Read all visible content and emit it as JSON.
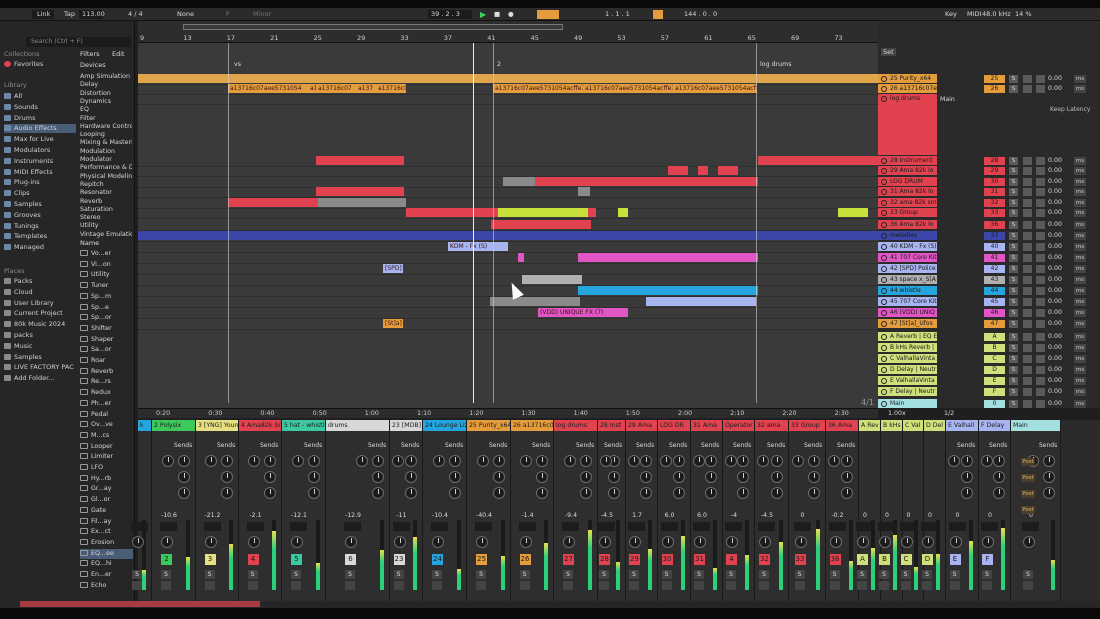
{
  "topbar": {
    "link": "Link",
    "tap": "Tap",
    "tempo": "113.00",
    "sig": "4 / 4",
    "quant": "None",
    "key_root": "F",
    "scale": "Minor",
    "position": "39 .  2 .  3",
    "loop_start": "1 .  1 .  1",
    "loop_len": "144 .  0 .  0",
    "key_label": "Key",
    "midi_label": "MIDI",
    "sample_rate": "48.0 kHz",
    "cpu": "14 %"
  },
  "browser": {
    "search_placeholder": "Search (Ctrl + F)",
    "filters": "Filters",
    "edit": "Edit",
    "collections": "Collections",
    "favorites": "Favorites",
    "library": "Library",
    "items": [
      "All",
      "Sounds",
      "Drums",
      "Audio Effects",
      "Max for Live",
      "Modulators",
      "Instruments",
      "MIDI Effects",
      "Plug-ins",
      "Clips",
      "Samples",
      "Grooves",
      "Tunings",
      "Templates",
      "Managed"
    ],
    "places": "Places",
    "place_items": [
      "Packs",
      "Cloud",
      "User Library",
      "Current Project",
      "80k Music 2024",
      "packs",
      "Music",
      "Samples",
      "LIVE FACTORY PAC",
      "Add Folder..."
    ],
    "devices_header": "Devices",
    "devices": [
      "Amp Simulation",
      "Delay",
      "Distortion",
      "Dynamics",
      "EQ",
      "Filter",
      "Hardware Control",
      "Looping",
      "Mixing & Mastering",
      "Modulation",
      "Modulator",
      "Performance & DJ",
      "Physical Modeling",
      "Repitch",
      "Resonator",
      "Reverb",
      "Saturation",
      "Stereo",
      "Utility",
      "Vintage Emulation"
    ],
    "name_header": "Name",
    "names": [
      "Vo...er",
      "Vi...on",
      "Utility",
      "Tuner",
      "Sp...m",
      "Sp...e",
      "Sp...or",
      "Shifter",
      "Shaper",
      "Sa...or",
      "Roar",
      "Reverb",
      "Re...rs",
      "Redux",
      "Ph...er",
      "Pedal",
      "Ov...ve",
      "M...cs",
      "Looper",
      "Limiter",
      "LFO",
      "Hy...rb",
      "Gr...ay",
      "Gl...or",
      "Gate",
      "Fil...ay",
      "Ex...ct",
      "Erosion",
      "EQ...ee",
      "EQ...hi",
      "En...er",
      "Echo"
    ]
  },
  "arrangement": {
    "ruler_numbers": [
      "9",
      "13",
      "17",
      "21",
      "25",
      "29",
      "33",
      "37",
      "41",
      "45",
      "49",
      "53",
      "57",
      "61",
      "65",
      "69",
      "73"
    ],
    "locators": [
      "vs",
      "2",
      "log drums"
    ],
    "clip_labels": [
      "a13716c07aee5731054",
      "a137",
      "a13716c07",
      "a137",
      "a13716c07aee",
      "a13716c07aee5731054acffe74",
      "a13716c07aee5731054acffe74",
      "a13716c07aee5731054acffe74"
    ],
    "other_labels": [
      "KDM - Fx (S)",
      "[SPD] P",
      "(VDD) UNIQUE FX (7)",
      "[St]a]"
    ],
    "time_markers": [
      "0:20",
      "0:30",
      "0:40",
      "0:50",
      "1:00",
      "1:10",
      "1:20",
      "1:30",
      "1:40",
      "1:50",
      "2:00",
      "2:10",
      "2:20",
      "2:30"
    ],
    "fraction": "4/1",
    "zoom": "1.00x"
  },
  "tracks": [
    {
      "name": "25 Purity_x64",
      "num": "25",
      "color": "#e59c3d",
      "val": "0.00"
    },
    {
      "name": "26 a13716c07e",
      "num": "26",
      "color": "#e59c3d",
      "val": "0.00"
    },
    {
      "name": "log drums",
      "num": "",
      "color": "#e0434f",
      "val": ""
    },
    {
      "name": "28 Instrument",
      "num": "28",
      "color": "#e0434f",
      "val": "0.00"
    },
    {
      "name": "29 Ama 82k lo",
      "num": "29",
      "color": "#e0434f",
      "val": "0.00"
    },
    {
      "name": "LOG DRUM",
      "num": "30",
      "color": "#e0434f",
      "val": "0.00"
    },
    {
      "name": "31 Ama 82k lo",
      "num": "31",
      "color": "#e0434f",
      "val": "0.00"
    },
    {
      "name": "32 ama 82k sm",
      "num": "32",
      "color": "#e0434f",
      "val": "0.00"
    },
    {
      "name": "33 Group",
      "num": "33",
      "color": "#e0434f",
      "val": "0.00"
    },
    {
      "name": "36 Ama 82k lo",
      "num": "36",
      "color": "#e0434f",
      "val": "0.00"
    },
    {
      "name": "melodies",
      "num": "37",
      "color": "#3b46a8",
      "val": "0.00"
    },
    {
      "name": "40 KDM - Fx (S)",
      "num": "40",
      "color": "#a8b4f0",
      "val": "0.00"
    },
    {
      "name": "41 707 Core Kit",
      "num": "41",
      "color": "#e255c5",
      "val": "0.00"
    },
    {
      "name": "42 [SPD] Police",
      "num": "42",
      "color": "#a8b4f0",
      "val": "0.00"
    },
    {
      "name": "43 space x_S[A",
      "num": "43",
      "color": "#b0b0b0",
      "val": "0.00"
    },
    {
      "name": "44 whistle",
      "num": "44",
      "color": "#25a5e0",
      "val": "0.00"
    },
    {
      "name": "45 707 Core Kit",
      "num": "45",
      "color": "#a8b4f0",
      "val": "0.00"
    },
    {
      "name": "46 (VDD) UNIQ",
      "num": "46",
      "color": "#e255c5",
      "val": "0.00"
    },
    {
      "name": "47 [St]a]_Ufos",
      "num": "47",
      "color": "#e59c3d",
      "val": "0.00"
    },
    {
      "name": "A Reverb | EQ Ei",
      "num": "A",
      "color": "#cfe07a",
      "val": "0.00"
    },
    {
      "name": "B kHs Reverb |",
      "num": "B",
      "color": "#cfe07a",
      "val": "0.00"
    },
    {
      "name": "C ValhallaVinta",
      "num": "C",
      "color": "#cfe07a",
      "val": "0.00"
    },
    {
      "name": "D Delay | Neutr",
      "num": "D",
      "color": "#cfe07a",
      "val": "0.00"
    },
    {
      "name": "E ValhallaVinta",
      "num": "E",
      "color": "#cfe07a",
      "val": "0.00"
    },
    {
      "name": "F Delay | Neutr",
      "num": "F",
      "color": "#cfe07a",
      "val": "0.00"
    },
    {
      "name": "Main",
      "num": "0",
      "color": "#a5e0e0",
      "val": "0.00"
    }
  ],
  "set_label": "Set",
  "main_label": "Main",
  "keep_latency": "Keep Latency",
  "ratio": "1/2",
  "sends": "Sends",
  "post": "Post",
  "mixer": [
    {
      "name": "k",
      "color": "#25a5e0",
      "db": "",
      "num": ""
    },
    {
      "name": "2 Polysix",
      "color": "#3cc85a",
      "db": "-10.6",
      "num": "2"
    },
    {
      "name": "3 [YNG] Youn",
      "color": "#e6e083",
      "db": "-21.2",
      "num": "3"
    },
    {
      "name": "4 Ama82k Sna",
      "color": "#e0434f",
      "db": "-2.1",
      "num": "4"
    },
    {
      "name": "5 hat - whistl",
      "color": "#3cc8a0",
      "db": "-12.1",
      "num": "5"
    },
    {
      "name": "drums",
      "color": "#d8d8d8",
      "db": "-12.9",
      "num": "6"
    },
    {
      "name": "23 [MDB]",
      "color": "#d8d8d8",
      "db": "-11",
      "num": "23"
    },
    {
      "name": "24 Lounge Liz",
      "color": "#25a5e0",
      "db": "-10.4",
      "num": "24"
    },
    {
      "name": "25 Purity_x64",
      "color": "#e59c3d",
      "db": "-40.4",
      "num": "25"
    },
    {
      "name": "26 a13716c07",
      "color": "#e59c3d",
      "db": "-1.4",
      "num": "26"
    },
    {
      "name": "log drums",
      "color": "#e0434f",
      "db": "-9.4",
      "num": "27"
    },
    {
      "name": "28 Inst",
      "color": "#e0434f",
      "db": "-4.5",
      "num": "28"
    },
    {
      "name": "29 Ama",
      "color": "#e0434f",
      "db": "1.7",
      "num": "29"
    },
    {
      "name": "LOG DR",
      "color": "#e0434f",
      "db": "6.0",
      "num": "30"
    },
    {
      "name": "31 Ama",
      "color": "#e0434f",
      "db": "6.0",
      "num": "31"
    },
    {
      "name": "Operator",
      "color": "#e0434f",
      "db": "-4",
      "num": "4"
    },
    {
      "name": "32 ama",
      "color": "#e0434f",
      "db": "-4.5",
      "num": "32"
    },
    {
      "name": "33 Group",
      "color": "#e0434f",
      "db": "0",
      "num": "33"
    },
    {
      "name": "36 Ama",
      "color": "#e0434f",
      "db": "-0.2",
      "num": "36"
    },
    {
      "name": "A Rev",
      "color": "#cfe07a",
      "db": "0",
      "num": "A"
    },
    {
      "name": "B kHs",
      "color": "#cfe07a",
      "db": "0",
      "num": "B"
    },
    {
      "name": "C Val",
      "color": "#cfe07a",
      "db": "0",
      "num": "C"
    },
    {
      "name": "D Del",
      "color": "#cfe07a",
      "db": "0",
      "num": "D"
    },
    {
      "name": "E Valhall",
      "color": "#a8b4f0",
      "db": "0",
      "num": "E"
    },
    {
      "name": "F Delay",
      "color": "#a8b4f0",
      "db": "0",
      "num": "F"
    },
    {
      "name": "Main",
      "color": "#a5e0e0",
      "db": "0",
      "num": ""
    }
  ]
}
